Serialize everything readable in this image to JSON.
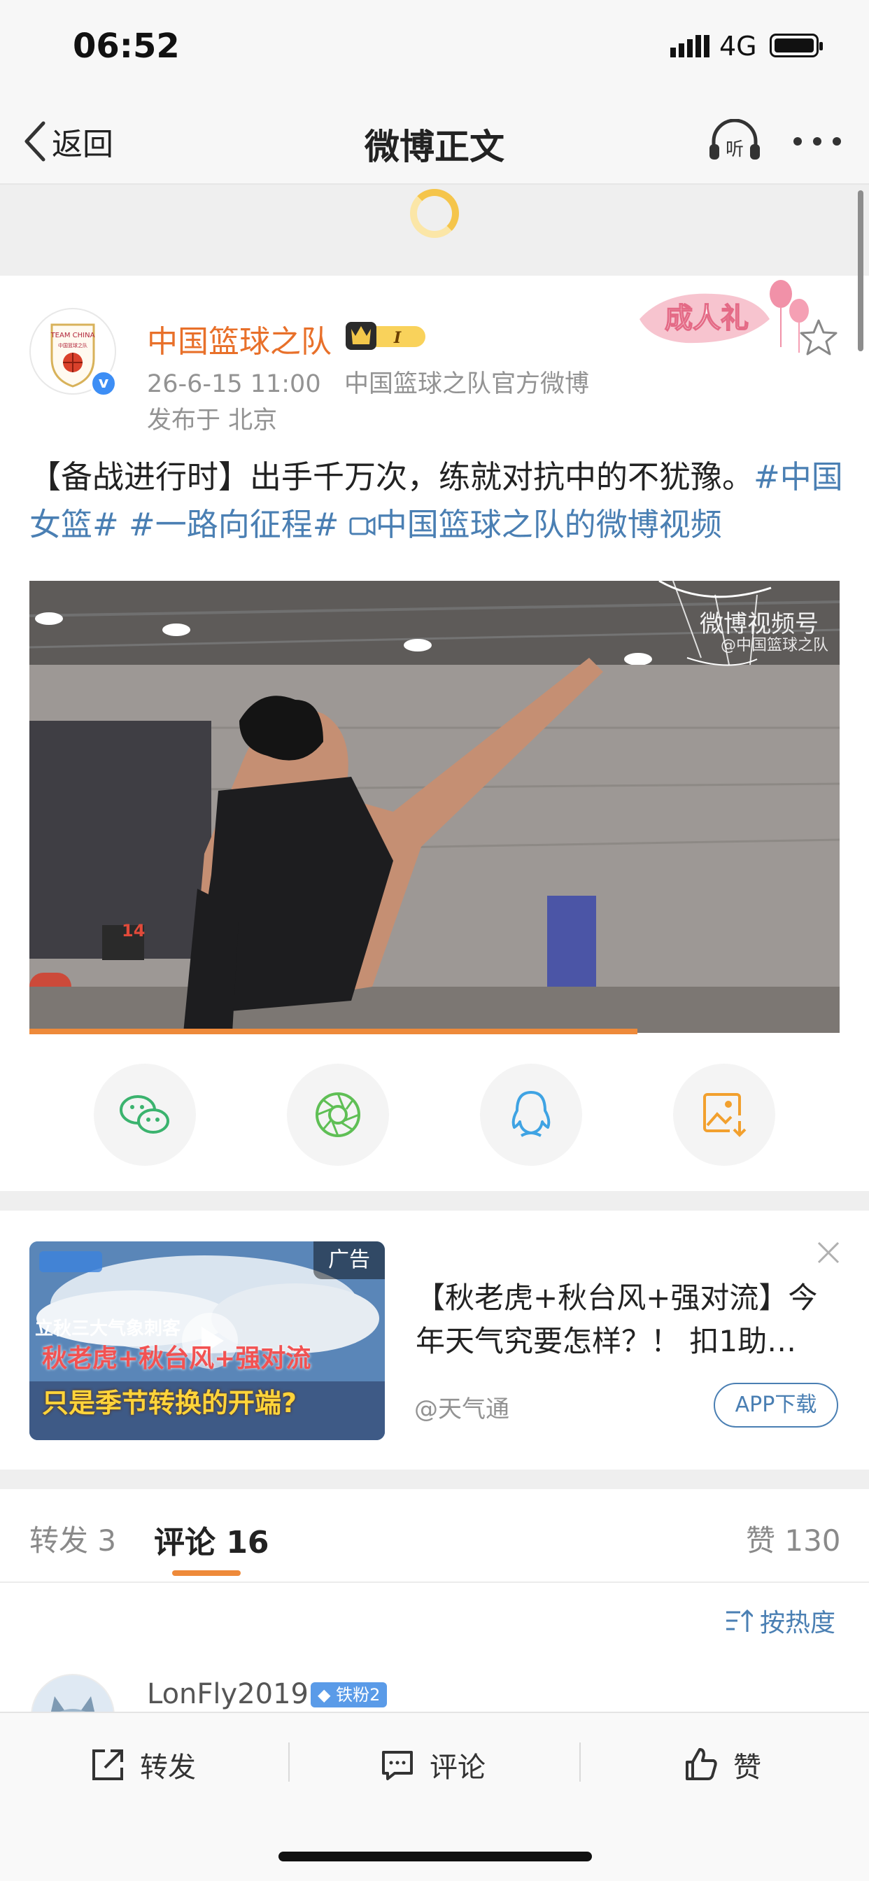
{
  "status_bar": {
    "time": "06:52",
    "network": "4G"
  },
  "nav": {
    "back_label": "返回",
    "title": "微博正文",
    "listen_label": "听"
  },
  "post": {
    "author": "中国篮球之队",
    "vip_level": "I",
    "avatar_text": "TEAM CHINA",
    "avatar_subtext": "中国篮球之队",
    "timestamp": "26-6-15 11:00",
    "source": "中国篮球之队官方微博",
    "location": "发布于 北京",
    "decoration_label": "成人礼",
    "text_plain": "【备战进行时】出手千万次，练就对抗中的不犹豫。",
    "tag_1": "#中国女篮#",
    "tag_2": "#一路向征程#",
    "video_link": "中国篮球之队的微博视频",
    "video": {
      "watermark": "微博视频号",
      "watermark_sub": "@中国篮球之队",
      "scoreboard": "14",
      "progress": 0.75
    }
  },
  "share_actions": [
    "wechat-icon",
    "moments-icon",
    "qq-icon",
    "save-image-icon"
  ],
  "ad": {
    "tag": "广告",
    "image_line1": "立秋三大气象刺客",
    "image_line2": "秋老虎+秋台风+强对流",
    "image_line3": "只是季节转换的开端?",
    "title": "【秋老虎+秋台风+强对流】今年天气究要怎样？！ 扣1助…",
    "source": "@天气通",
    "button": "APP下载"
  },
  "tabs": {
    "repost": "转发 3",
    "comment": "评论 16",
    "like": "赞 130"
  },
  "sort_label": "按热度",
  "comment": {
    "username": "LonFly2019",
    "fan_badge": "铁粉2"
  },
  "bottom_bar": {
    "repost": "转发",
    "comment": "评论",
    "like": "赞"
  },
  "colors": {
    "accent": "#ee8a3a",
    "author": "#e8702a",
    "link": "#4a7fb3"
  }
}
